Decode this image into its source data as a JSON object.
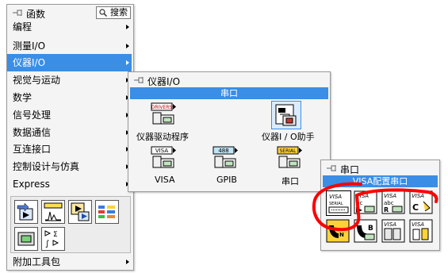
{
  "functions_palette": {
    "title": "函数",
    "search_label": "搜索",
    "items": [
      {
        "label": "编程",
        "submenu": true
      },
      {
        "label": "测量I/O",
        "submenu": true
      },
      {
        "label": "仪器I/O",
        "submenu": true,
        "selected": true
      },
      {
        "label": "视觉与运动",
        "submenu": true
      },
      {
        "label": "数学",
        "submenu": true
      },
      {
        "label": "信号处理",
        "submenu": true
      },
      {
        "label": "数据通信",
        "submenu": true
      },
      {
        "label": "互连接口",
        "submenu": true
      },
      {
        "label": "控制设计与仿真",
        "submenu": true
      },
      {
        "label": "Express",
        "submenu": true
      }
    ],
    "bottom_item": "附加工具包",
    "express_icons": [
      "express-input-icon",
      "express-waveform-icon",
      "express-signal-icon",
      "express-table-icon",
      "express-display-icon",
      "express-arith-icon"
    ]
  },
  "instrument_palette": {
    "title": "仪器I/O",
    "header": "串口",
    "items": [
      {
        "label": "仪器驱动程序",
        "icon_text": "DRIVERS"
      },
      {
        "label": "仪器I / O助手",
        "icon_text": ""
      },
      {
        "label": "VISA",
        "icon_text": "VISA"
      },
      {
        "label": "GPIB",
        "icon_text": "488"
      },
      {
        "label": "串口",
        "icon_text": "SERIAL"
      }
    ]
  },
  "serial_palette": {
    "title": "串口",
    "header": "VISA配置串口",
    "icons": [
      {
        "name": "visa-serial-config-icon",
        "text": "VISA SERIAL"
      },
      {
        "name": "visa-write-icon",
        "text": "VISA"
      },
      {
        "name": "visa-read-icon",
        "text": "VISA abc"
      },
      {
        "name": "visa-close-icon",
        "text": "VISA"
      },
      {
        "name": "visa-bytes-at-port-icon",
        "text": ""
      },
      {
        "name": "visa-break-icon",
        "text": ""
      },
      {
        "name": "visa-flush-icon",
        "text": "VISA"
      },
      {
        "name": "visa-serial-misc-icon",
        "text": "VISA"
      }
    ]
  },
  "colors": {
    "selection_blue": "#3a8ee6",
    "annotation_red": "#ff0000"
  }
}
